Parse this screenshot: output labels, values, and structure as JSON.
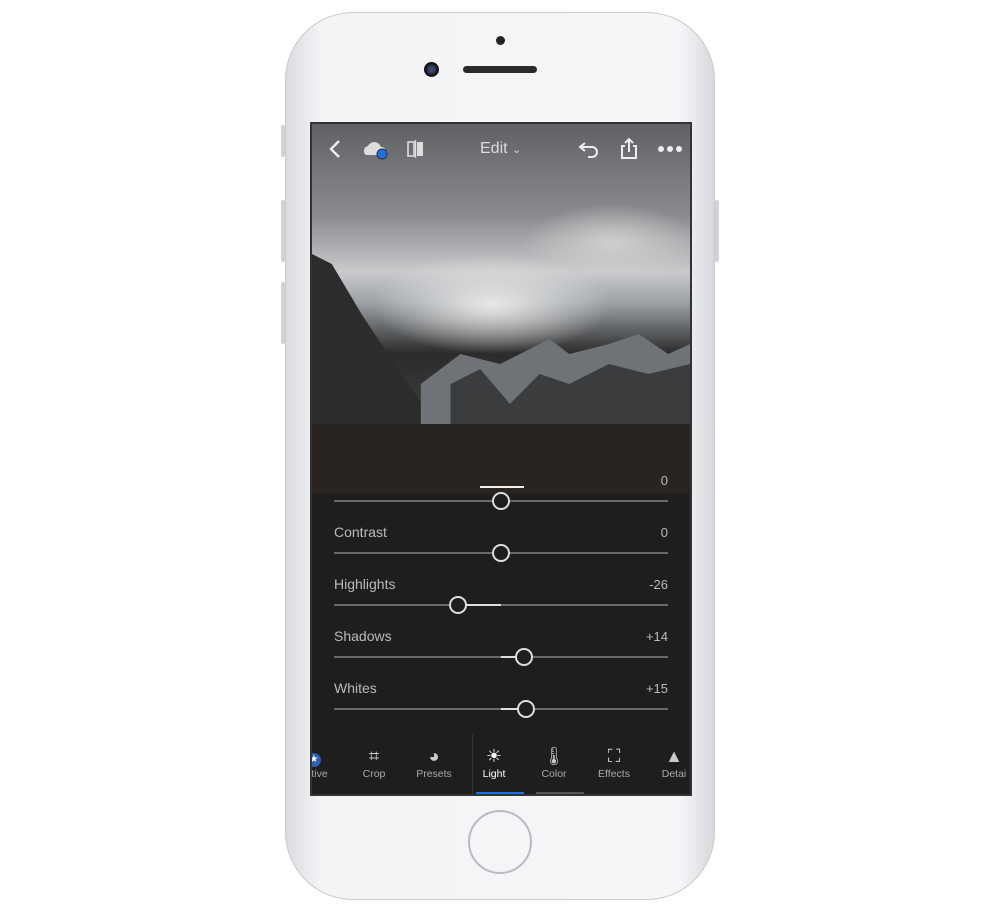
{
  "topbar": {
    "title": "Edit",
    "icons": [
      "back-icon",
      "cloud-sync-icon",
      "compare-icon",
      "undo-icon",
      "share-icon",
      "more-icon"
    ]
  },
  "sliders": [
    {
      "label": "",
      "value": "0",
      "level": 0
    },
    {
      "label": "Contrast",
      "value": "0",
      "level": 0
    },
    {
      "label": "Highlights",
      "value": "-26",
      "level": -26
    },
    {
      "label": "Shadows",
      "value": "+14",
      "level": 14
    },
    {
      "label": "Whites",
      "value": "+15",
      "level": 15
    }
  ],
  "tabs": [
    {
      "label": "ective",
      "icon": "selective-icon"
    },
    {
      "label": "Crop",
      "icon": "crop-icon"
    },
    {
      "label": "Presets",
      "icon": "presets-icon"
    },
    {
      "label": "Light",
      "icon": "sun-icon",
      "active": true
    },
    {
      "label": "Color",
      "icon": "thermometer-icon"
    },
    {
      "label": "Effects",
      "icon": "effects-icon"
    },
    {
      "label": "Detai",
      "icon": "detail-icon"
    }
  ],
  "colors": {
    "accent": "#1473e6",
    "sync_dot": "#1f6fe6"
  }
}
